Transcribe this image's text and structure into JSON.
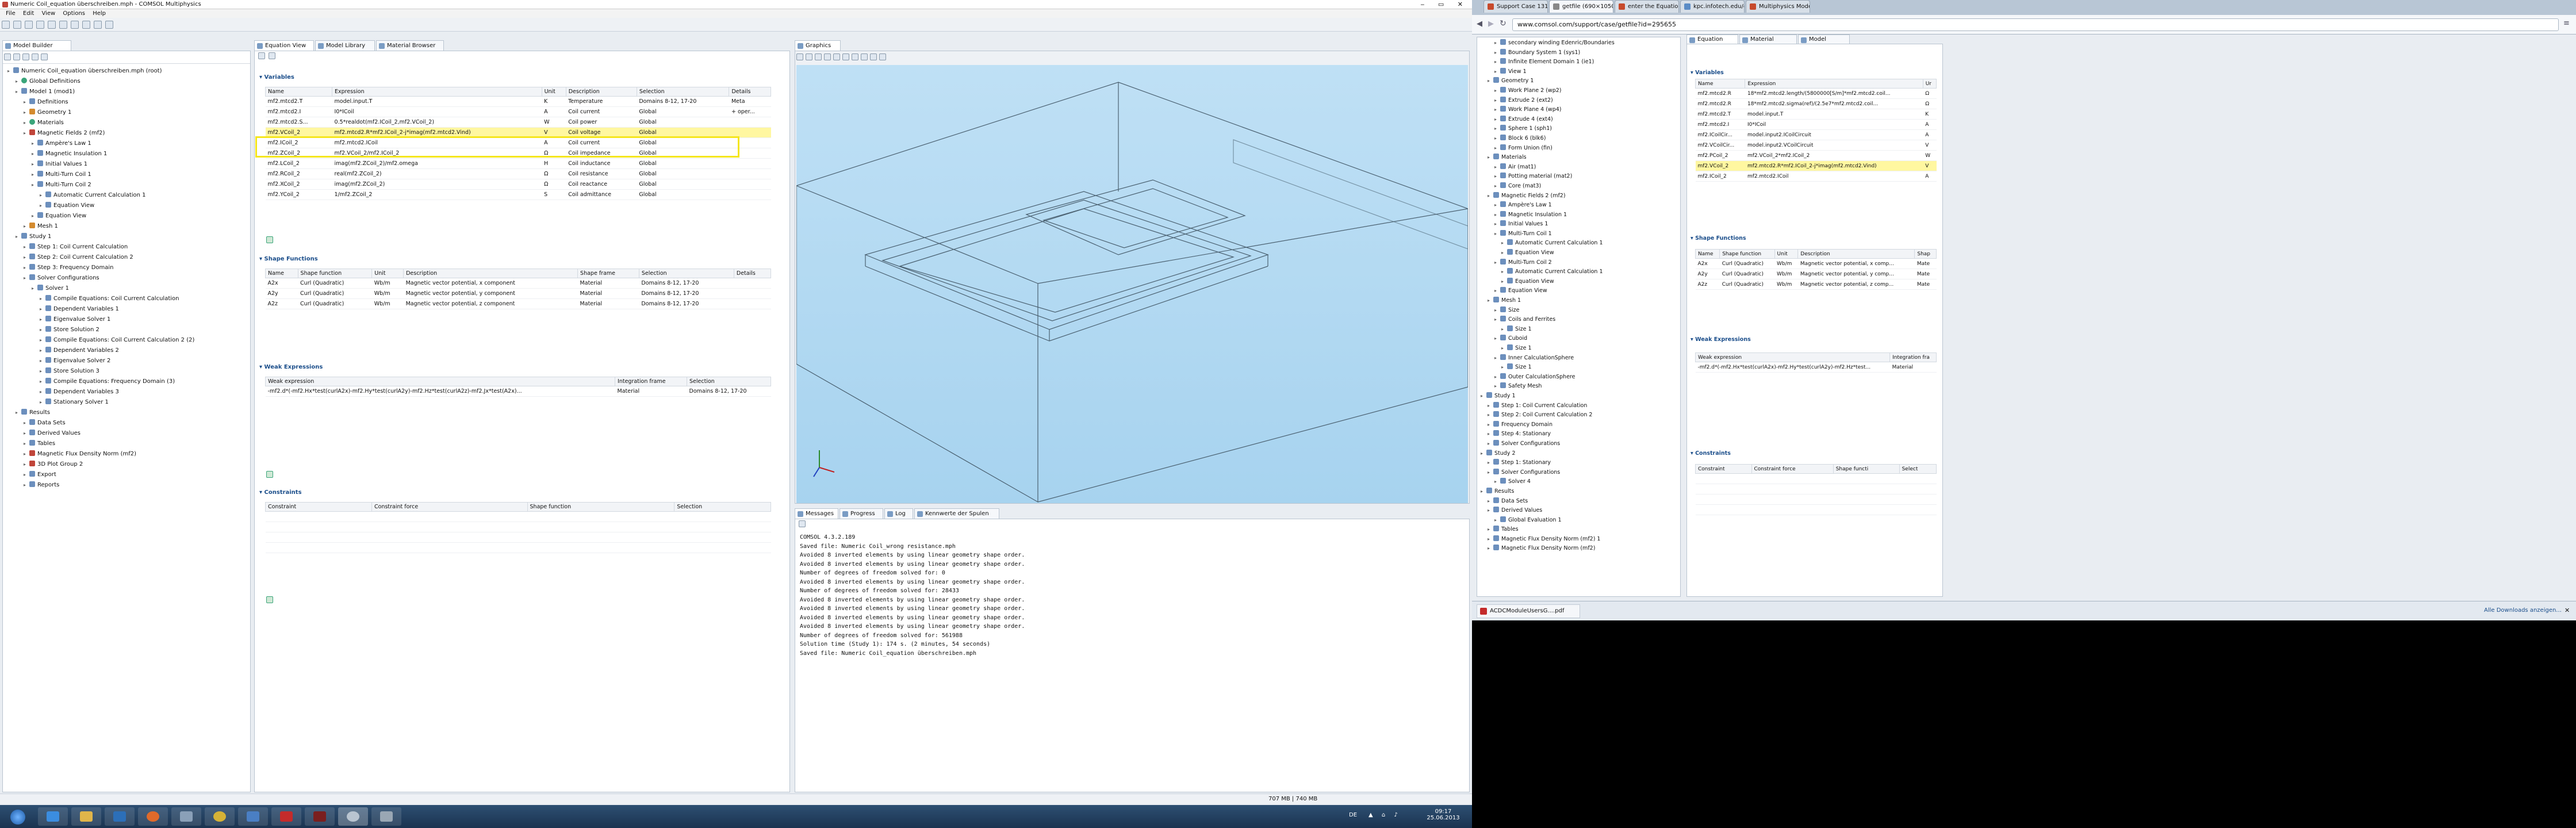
{
  "left_window": {
    "title": "Numeric Coil_equation überschreiben.mph - COMSOL Multiphysics",
    "menu": [
      "File",
      "Edit",
      "View",
      "Options",
      "Help"
    ],
    "model_builder_tab": "Model Builder",
    "tree": [
      {
        "label": "Numeric Coil_equation überschreiben.mph (root)",
        "depth": 0,
        "ic": "b"
      },
      {
        "label": "Global Definitions",
        "depth": 1,
        "ic": "g"
      },
      {
        "label": "Model 1 (mod1)",
        "depth": 1,
        "ic": "b"
      },
      {
        "label": "Definitions",
        "depth": 2,
        "ic": "b"
      },
      {
        "label": "Geometry 1",
        "depth": 2,
        "ic": "o"
      },
      {
        "label": "Materials",
        "depth": 2,
        "ic": "g"
      },
      {
        "label": "Magnetic Fields 2 (mf2)",
        "depth": 2,
        "ic": "r"
      },
      {
        "label": "Ampère's Law 1",
        "depth": 3,
        "ic": "b"
      },
      {
        "label": "Magnetic Insulation 1",
        "depth": 3,
        "ic": "b"
      },
      {
        "label": "Initial Values 1",
        "depth": 3,
        "ic": "b"
      },
      {
        "label": "Multi-Turn Coil 1",
        "depth": 3,
        "ic": "b"
      },
      {
        "label": "Multi-Turn Coil 2",
        "depth": 3,
        "ic": "b"
      },
      {
        "label": "Automatic Current Calculation 1",
        "depth": 4,
        "ic": "b"
      },
      {
        "label": "Equation View",
        "depth": 4,
        "ic": "b"
      },
      {
        "label": "Equation View",
        "depth": 3,
        "ic": "b"
      },
      {
        "label": "Mesh 1",
        "depth": 2,
        "ic": "o"
      },
      {
        "label": "Study 1",
        "depth": 1,
        "ic": "b"
      },
      {
        "label": "Step 1: Coil Current Calculation",
        "depth": 2,
        "ic": "b"
      },
      {
        "label": "Step 2: Coil Current Calculation 2",
        "depth": 2,
        "ic": "b"
      },
      {
        "label": "Step 3: Frequency Domain",
        "depth": 2,
        "ic": "b"
      },
      {
        "label": "Solver Configurations",
        "depth": 2,
        "ic": "b"
      },
      {
        "label": "Solver 1",
        "depth": 3,
        "ic": "b"
      },
      {
        "label": "Compile Equations: Coil Current Calculation",
        "depth": 4,
        "ic": "b"
      },
      {
        "label": "Dependent Variables 1",
        "depth": 4,
        "ic": "b"
      },
      {
        "label": "Eigenvalue Solver 1",
        "depth": 4,
        "ic": "b"
      },
      {
        "label": "Store Solution 2",
        "depth": 4,
        "ic": "b"
      },
      {
        "label": "Compile Equations: Coil Current Calculation 2 (2)",
        "depth": 4,
        "ic": "b"
      },
      {
        "label": "Dependent Variables 2",
        "depth": 4,
        "ic": "b"
      },
      {
        "label": "Eigenvalue Solver 2",
        "depth": 4,
        "ic": "b"
      },
      {
        "label": "Store Solution 3",
        "depth": 4,
        "ic": "b"
      },
      {
        "label": "Compile Equations: Frequency Domain (3)",
        "depth": 4,
        "ic": "b"
      },
      {
        "label": "Dependent Variables 3",
        "depth": 4,
        "ic": "b"
      },
      {
        "label": "Stationary Solver 1",
        "depth": 4,
        "ic": "b"
      },
      {
        "label": "Results",
        "depth": 1,
        "ic": "b"
      },
      {
        "label": "Data Sets",
        "depth": 2,
        "ic": "b"
      },
      {
        "label": "Derived Values",
        "depth": 2,
        "ic": "b"
      },
      {
        "label": "Tables",
        "depth": 2,
        "ic": "b"
      },
      {
        "label": "Magnetic Flux Density Norm (mf2)",
        "depth": 2,
        "ic": "r"
      },
      {
        "label": "3D Plot Group 2",
        "depth": 2,
        "ic": "r"
      },
      {
        "label": "Export",
        "depth": 2,
        "ic": "b"
      },
      {
        "label": "Reports",
        "depth": 2,
        "ic": "b"
      }
    ],
    "settings_tabs": [
      "Equation View",
      "Model Library",
      "Material Browser"
    ],
    "sections": {
      "variables": "Variables",
      "shape": "Shape Functions",
      "weak": "Weak Expressions",
      "constraints": "Constraints"
    },
    "var_cols": [
      "Name",
      "Expression",
      "Unit",
      "Description",
      "Selection",
      "Details"
    ],
    "var_rows": [
      [
        "mf2.mtcd2.T",
        "model.input.T",
        "K",
        "Temperature",
        "Domains 8-12, 17-20",
        "Meta"
      ],
      [
        "mf2.mtcd2.I",
        "I0*ICoil",
        "A",
        "Coil current",
        "Global",
        "+ oper..."
      ],
      [
        "mf2.mtcd2.S...",
        "0.5*realdot(mf2.ICoil_2,mf2.VCoil_2)",
        "W",
        "Coil power",
        "Global",
        ""
      ],
      [
        "mf2.VCoil_2",
        "mf2.mtcd2.R*mf2.ICoil_2-j*imag(mf2.mtcd2.Vind)",
        "V",
        "Coil voltage",
        "Global",
        ""
      ],
      [
        "mf2.ICoil_2",
        "mf2.mtcd2.ICoil",
        "A",
        "Coil current",
        "Global",
        ""
      ],
      [
        "mf2.ZCoil_2",
        "mf2.VCoil_2/mf2.ICoil_2",
        "Ω",
        "Coil impedance",
        "Global",
        ""
      ],
      [
        "mf2.LCoil_2",
        "imag(mf2.ZCoil_2)/mf2.omega",
        "H",
        "Coil inductance",
        "Global",
        ""
      ],
      [
        "mf2.RCoil_2",
        "real(mf2.ZCoil_2)",
        "Ω",
        "Coil resistance",
        "Global",
        ""
      ],
      [
        "mf2.XCoil_2",
        "imag(mf2.ZCoil_2)",
        "Ω",
        "Coil reactance",
        "Global",
        ""
      ],
      [
        "mf2.YCoil_2",
        "1/mf2.ZCoil_2",
        "S",
        "Coil admittance",
        "Global",
        ""
      ]
    ],
    "shape_cols": [
      "Name",
      "Shape function",
      "Unit",
      "Description",
      "Shape frame",
      "Selection",
      "Details"
    ],
    "shape_rows": [
      [
        "A2x",
        "Curl (Quadratic)",
        "Wb/m",
        "Magnetic vector potential, x component",
        "Material",
        "Domains 8-12, 17-20",
        ""
      ],
      [
        "A2y",
        "Curl (Quadratic)",
        "Wb/m",
        "Magnetic vector potential, y component",
        "Material",
        "Domains 8-12, 17-20",
        ""
      ],
      [
        "A2z",
        "Curl (Quadratic)",
        "Wb/m",
        "Magnetic vector potential, z component",
        "Material",
        "Domains 8-12, 17-20",
        ""
      ]
    ],
    "weak_cols": [
      "Weak expression",
      "Integration frame",
      "Selection"
    ],
    "weak_rows": [
      [
        "-mf2.d*(-mf2.Hx*test(curlA2x)-mf2.Hy*test(curlA2y)-mf2.Hz*test(curlA2z)-mf2.Jx*test(A2x)...",
        "Material",
        "Domains 8-12, 17-20"
      ]
    ],
    "cons_cols": [
      "Constraint",
      "Constraint force",
      "Shape function",
      "Selection"
    ],
    "graphics_tab": "Graphics",
    "messages_tabs": [
      "Messages",
      "Progress",
      "Log",
      "Kennwerte der Spulen"
    ],
    "messages": [
      "COMSOL 4.3.2.189",
      "Saved file: Numeric Coil_wrong resistance.mph",
      "Avoided 8 inverted elements by using linear geometry shape order.",
      "Avoided 8 inverted elements by using linear geometry shape order.",
      "Number of degrees of freedom solved for: 0",
      "Avoided 8 inverted elements by using linear geometry shape order.",
      "Number of degrees of freedom solved for: 28433",
      "Avoided 8 inverted elements by using linear geometry shape order.",
      "Avoided 8 inverted elements by using linear geometry shape order.",
      "Avoided 8 inverted elements by using linear geometry shape order.",
      "Avoided 8 inverted elements by using linear geometry shape order.",
      "Number of degrees of freedom solved for: 561988",
      "Solution time (Study 1): 174 s. (2 minutes, 54 seconds)",
      "Saved file: Numeric Coil_equation überschreiben.mph"
    ],
    "memory": "707 MB | 740 MB",
    "clock_time": "09:17",
    "clock_date": "25.06.2013",
    "lang": "DE"
  },
  "right_window": {
    "tabs": [
      "Support Case 1318817",
      "getfile (690×1050)",
      "enter the Equation View",
      "kpc.infotech.edu/comsol/...",
      "Multiphysics Modeling an..."
    ],
    "url": "www.comsol.com/support/case/getfile?id=295655",
    "tree": [
      {
        "label": "secondary winding Edenric/Boundaries",
        "depth": 2
      },
      {
        "label": "Boundary System 1 (sys1)",
        "depth": 2
      },
      {
        "label": "Infinite Element Domain 1 (ie1)",
        "depth": 2
      },
      {
        "label": "View 1",
        "depth": 2
      },
      {
        "label": "Geometry 1",
        "depth": 1
      },
      {
        "label": "Work Plane 2 (wp2)",
        "depth": 2
      },
      {
        "label": "Extrude 2 (ext2)",
        "depth": 2
      },
      {
        "label": "Work Plane 4 (wp4)",
        "depth": 2
      },
      {
        "label": "Extrude 4 (ext4)",
        "depth": 2
      },
      {
        "label": "Sphere 1 (sph1)",
        "depth": 2
      },
      {
        "label": "Block 6 (blk6)",
        "depth": 2
      },
      {
        "label": "Form Union (fin)",
        "depth": 2
      },
      {
        "label": "Materials",
        "depth": 1
      },
      {
        "label": "Air (mat1)",
        "depth": 2
      },
      {
        "label": "Potting material (mat2)",
        "depth": 2
      },
      {
        "label": "Core (mat3)",
        "depth": 2
      },
      {
        "label": "Magnetic Fields 2 (mf2)",
        "depth": 1
      },
      {
        "label": "Ampère's Law 1",
        "depth": 2
      },
      {
        "label": "Magnetic Insulation 1",
        "depth": 2
      },
      {
        "label": "Initial Values 1",
        "depth": 2
      },
      {
        "label": "Multi-Turn Coil 1",
        "depth": 2
      },
      {
        "label": "Automatic Current Calculation 1",
        "depth": 3
      },
      {
        "label": "Equation View",
        "depth": 3
      },
      {
        "label": "Multi-Turn Coil 2",
        "depth": 2
      },
      {
        "label": "Automatic Current Calculation 1",
        "depth": 3
      },
      {
        "label": "Equation View",
        "depth": 3
      },
      {
        "label": "Equation View",
        "depth": 2
      },
      {
        "label": "Mesh 1",
        "depth": 1
      },
      {
        "label": "Size",
        "depth": 2
      },
      {
        "label": "Coils and Ferrites",
        "depth": 2
      },
      {
        "label": "Size 1",
        "depth": 3
      },
      {
        "label": "Cuboid",
        "depth": 2
      },
      {
        "label": "Size 1",
        "depth": 3
      },
      {
        "label": "Inner CalculationSphere",
        "depth": 2
      },
      {
        "label": "Size 1",
        "depth": 3
      },
      {
        "label": "Outer CalculationSphere",
        "depth": 2
      },
      {
        "label": "Safety Mesh",
        "depth": 2
      },
      {
        "label": "Study 1",
        "depth": 0
      },
      {
        "label": "Step 1: Coil Current Calculation",
        "depth": 1
      },
      {
        "label": "Step 2: Coil Current Calculation 2",
        "depth": 1
      },
      {
        "label": "Frequency Domain",
        "depth": 1
      },
      {
        "label": "Step 4: Stationary",
        "depth": 1
      },
      {
        "label": "Solver Configurations",
        "depth": 1
      },
      {
        "label": "Study 2",
        "depth": 0
      },
      {
        "label": "Step 1: Stationary",
        "depth": 1
      },
      {
        "label": "Solver Configurations",
        "depth": 1
      },
      {
        "label": "Solver 4",
        "depth": 2
      },
      {
        "label": "Results",
        "depth": 0
      },
      {
        "label": "Data Sets",
        "depth": 1
      },
      {
        "label": "Derived Values",
        "depth": 1
      },
      {
        "label": "Global Evaluation 1",
        "depth": 2
      },
      {
        "label": "Tables",
        "depth": 1
      },
      {
        "label": "Magnetic Flux Density Norm (mf2) 1",
        "depth": 1
      },
      {
        "label": "Magnetic Flux Density Norm (mf2)",
        "depth": 1
      }
    ],
    "settings_tabs": [
      "Equation View",
      "Material Browser",
      "Model Library"
    ],
    "var_cols": [
      "Name",
      "Expression",
      "Ur"
    ],
    "var_rows": [
      [
        "mf2.mtcd2.R",
        "18*mf2.mtcd2.length/(5800000[S/m]*mf2.mtcd2.coil...",
        "Ω"
      ],
      [
        "mf2.mtcd2.R",
        "18*mf2.mtcd2.sigma(ref)/(2.5e7*mf2.mtcd2.coil...",
        "Ω"
      ],
      [
        "mf2.mtcd2.T",
        "model.input.T",
        "K"
      ],
      [
        "mf2.mtcd2.I",
        "I0*ICoil",
        "A"
      ],
      [
        "mf2.ICoilCir...",
        "model.input2.ICoilCircuit",
        "A"
      ],
      [
        "mf2.VCoilCir...",
        "model.input2.VCoilCircuit",
        "V"
      ],
      [
        "mf2.PCoil_2",
        "mf2.VCoil_2*mf2.ICoil_2",
        "W"
      ],
      [
        "mf2.VCoil_2",
        "mf2.mtcd2.R*mf2.ICoil_2-j*imag(mf2.mtcd2.Vind)",
        "V"
      ],
      [
        "mf2.ICoil_2",
        "mf2.mtcd2.ICoil",
        "A"
      ]
    ],
    "sections": {
      "variables": "Variables",
      "shape": "Shape Functions",
      "weak": "Weak Expressions",
      "constraints": "Constraints"
    },
    "shape_cols": [
      "Name",
      "Shape function",
      "Unit",
      "Description",
      "Shap"
    ],
    "shape_rows": [
      [
        "A2x",
        "Curl (Quadratic)",
        "Wb/m",
        "Magnetic vector potential, x comp...",
        "Mate"
      ],
      [
        "A2y",
        "Curl (Quadratic)",
        "Wb/m",
        "Magnetic vector potential, y comp...",
        "Mate"
      ],
      [
        "A2z",
        "Curl (Quadratic)",
        "Wb/m",
        "Magnetic vector potential, z comp...",
        "Mate"
      ]
    ],
    "weak_cols": [
      "Weak expression",
      "Integration fra"
    ],
    "weak_rows": [
      [
        "-mf2.d*(-mf2.Hx*test(curlA2x)-mf2.Hy*test(curlA2y)-mf2.Hz*test...",
        "Material"
      ]
    ],
    "cons_cols": [
      "Constraint",
      "Constraint force",
      "Shape functi",
      "Select"
    ],
    "download_file": "ACDCModuleUsersG....pdf",
    "download_all": "Alle Downloads anzeigen..."
  },
  "colors": {
    "highlight": "#f5e61d",
    "row_highlight": "#fff7a0",
    "accent": "#1a4d8a",
    "graphics_bg": "#a7d3ef"
  }
}
